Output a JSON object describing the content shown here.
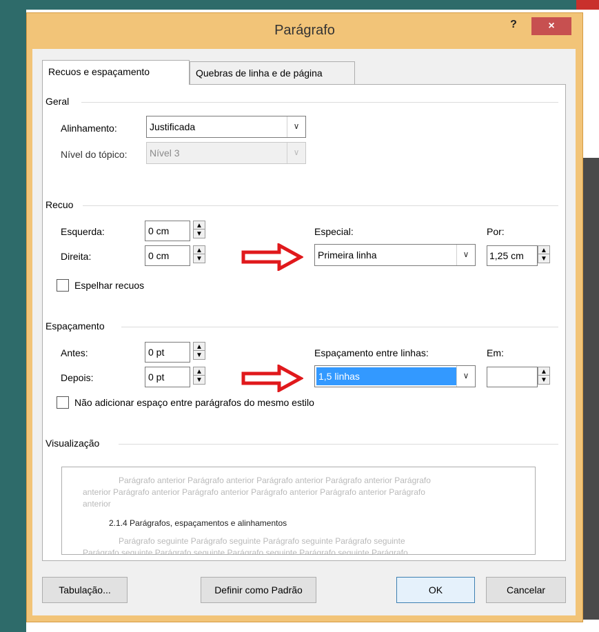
{
  "dialog": {
    "title": "Parágrafo",
    "help_label": "?",
    "close_label": "×"
  },
  "tabs": [
    {
      "label": "Recuos e espaçamento"
    },
    {
      "label": "Quebras de linha e de página"
    }
  ],
  "general": {
    "title": "Geral",
    "alignment_label": "Alinhamento:",
    "alignment_value": "Justificada",
    "outline_label": "Nível do tópico:",
    "outline_value": "Nível 3"
  },
  "indent": {
    "title": "Recuo",
    "left_label": "Esquerda:",
    "left_value": "0 cm",
    "right_label": "Direita:",
    "right_value": "0 cm",
    "special_label": "Especial:",
    "special_value": "Primeira linha",
    "by_label": "Por:",
    "by_value": "1,25 cm",
    "mirror_label": "Espelhar recuos"
  },
  "spacing": {
    "title": "Espaçamento",
    "before_label": "Antes:",
    "before_value": "0 pt",
    "after_label": "Depois:",
    "after_value": "0 pt",
    "line_spacing_label": "Espaçamento entre linhas:",
    "line_spacing_value": "1,5 linhas",
    "at_label": "Em:",
    "at_value": "",
    "no_space_label": "Não adicionar espaço entre parágrafos do mesmo estilo"
  },
  "preview": {
    "title": "Visualização",
    "prev_line1": "Parágrafo anterior Parágrafo anterior Parágrafo anterior Parágrafo anterior Parágrafo",
    "prev_line2": "anterior Parágrafo anterior Parágrafo anterior Parágrafo anterior Parágrafo anterior Parágrafo",
    "prev_line3": "anterior",
    "current": "2.1.4 Parágrafos, espaçamentos e alinhamentos",
    "next_line1": "Parágrafo seguinte Parágrafo seguinte Parágrafo seguinte Parágrafo seguinte",
    "next_line2": "Parágrafo seguinte Parágrafo seguinte Parágrafo seguinte Parágrafo seguinte Parágrafo"
  },
  "buttons": {
    "tabs": "Tabulação...",
    "set_default": "Definir como Padrão",
    "ok": "OK",
    "cancel": "Cancelar"
  },
  "colors": {
    "dialog_frame": "#f2c478",
    "close_button": "#c75050",
    "annotation_arrow": "#e0191c",
    "selection": "#3399ff"
  }
}
